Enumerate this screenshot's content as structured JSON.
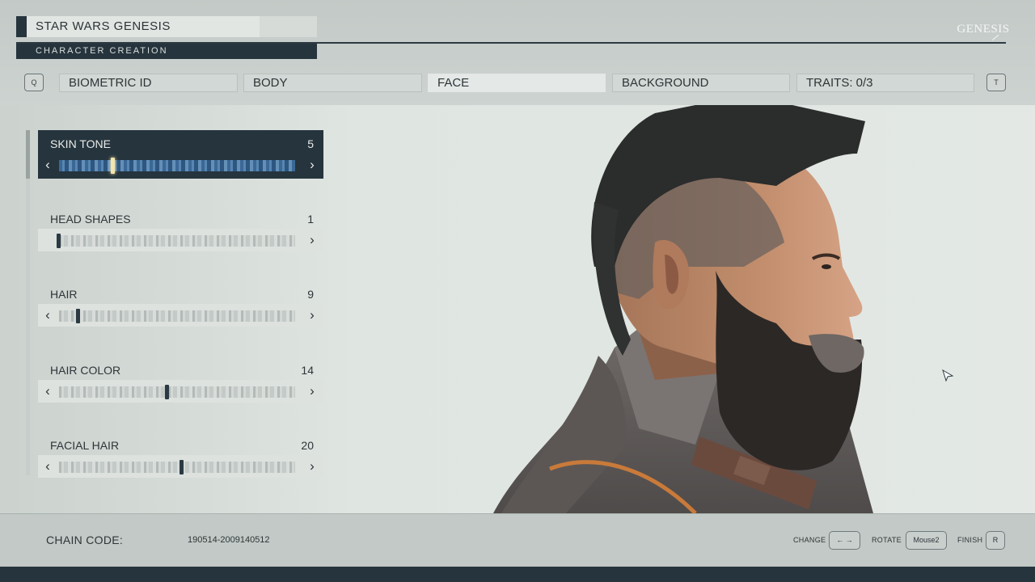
{
  "header": {
    "title": "STAR WARS GENESIS",
    "subtitle": "CHARACTER CREATION",
    "logo_text": "GENESIS"
  },
  "tabs": {
    "prev_key": "Q",
    "next_key": "T",
    "items": [
      {
        "label": "BIOMETRIC ID",
        "active": false
      },
      {
        "label": "BODY",
        "active": false
      },
      {
        "label": "FACE",
        "active": true
      },
      {
        "label": "BACKGROUND",
        "active": false
      },
      {
        "label": "TRAITS: 0/3",
        "active": false
      }
    ]
  },
  "sliders": [
    {
      "label": "SKIN TONE",
      "value": "5",
      "selected": true,
      "position": 0.24
    },
    {
      "label": "HEAD SHAPES",
      "value": "1",
      "selected": false,
      "position": 0.0
    },
    {
      "label": "HAIR",
      "value": "9",
      "selected": false,
      "position": 0.08
    },
    {
      "label": "HAIR COLOR",
      "value": "14",
      "selected": false,
      "position": 0.45
    },
    {
      "label": "FACIAL HAIR",
      "value": "20",
      "selected": false,
      "position": 0.51
    }
  ],
  "footer": {
    "chain_label": "CHAIN CODE:",
    "chain_value": "190514-2009140512",
    "hints": [
      {
        "label": "CHANGE",
        "key": "← →"
      },
      {
        "label": "ROTATE",
        "key": "Mouse2"
      },
      {
        "label": "FINISH",
        "key": "R"
      }
    ]
  },
  "colors": {
    "accent_dark": "#26343d",
    "panel_light": "#e2e6e3",
    "slider_active_blue": "#3d6ea0",
    "marker_highlight": "#f2e5b0"
  },
  "icons": {
    "left_arrow": "chevron-left-icon",
    "right_arrow": "chevron-right-icon",
    "cursor": "mouse-cursor-icon"
  }
}
